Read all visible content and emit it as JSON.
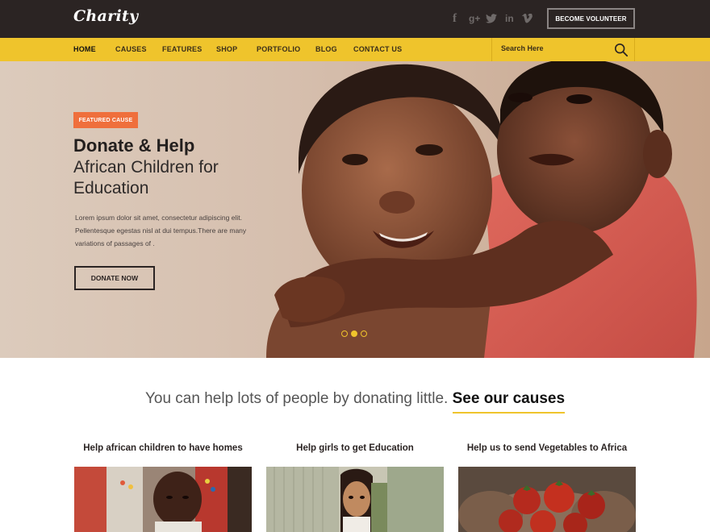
{
  "brand": {
    "logo": "Charity"
  },
  "header": {
    "social": [
      {
        "icon": "facebook-icon",
        "glyph": "f"
      },
      {
        "icon": "google-plus-icon",
        "glyph": "g+"
      },
      {
        "icon": "twitter-icon",
        "glyph": "t"
      },
      {
        "icon": "linkedin-icon",
        "glyph": "in"
      },
      {
        "icon": "vimeo-icon",
        "glyph": "v"
      }
    ],
    "volunteer_label": "BECOME VOLUNTEER"
  },
  "nav": {
    "items": [
      "HOME",
      "CAUSES",
      "FEATURES",
      "SHOP",
      "PORTFOLIO",
      "BLOG",
      "CONTACT US"
    ],
    "active": "HOME",
    "search_placeholder": "Search Here"
  },
  "hero": {
    "badge": "FEATURED CAUSE",
    "title": "Donate & Help",
    "subtitle_line1": "African Children for",
    "subtitle_line2": "Education",
    "description": "Lorem ipsum dolor sit amet, consectetur adipiscing elit. Pellentesque egestas nisl at dui tempus.There are many variations of passages of .",
    "button": "DONATE NOW",
    "slides": 3,
    "active_slide": 2
  },
  "causes": {
    "lead": "You can help lots of people by donating little.",
    "link": "See our causes",
    "items": [
      {
        "title": "Help african children to have homes"
      },
      {
        "title": "Help girls to get Education"
      },
      {
        "title": "Help us to send Vegetables to Africa"
      }
    ]
  },
  "colors": {
    "topbar": "#2b2423",
    "accent": "#efc42c",
    "badge": "#ef6f3c"
  }
}
